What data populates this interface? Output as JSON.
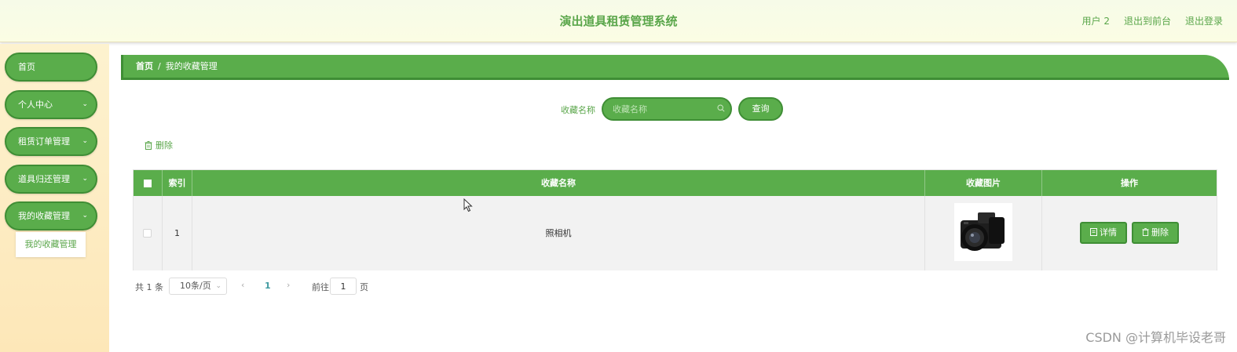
{
  "header": {
    "title": "演出道具租赁管理系统",
    "links": [
      "用户 2",
      "退出到前台",
      "退出登录"
    ]
  },
  "sidebar": {
    "items": [
      {
        "label": "首页",
        "has_arrow": false
      },
      {
        "label": "个人中心",
        "has_arrow": true
      },
      {
        "label": "租赁订单管理",
        "has_arrow": true
      },
      {
        "label": "道具归还管理",
        "has_arrow": true
      },
      {
        "label": "我的收藏管理",
        "has_arrow": true
      }
    ],
    "submenu": {
      "label": "我的收藏管理"
    }
  },
  "breadcrumb": {
    "home": "首页",
    "separator": "/",
    "current": "我的收藏管理"
  },
  "search": {
    "label": "收藏名称",
    "placeholder": "收藏名称",
    "button": "查询"
  },
  "actions": {
    "bulk_delete": "删除"
  },
  "table": {
    "headers": [
      "索引",
      "收藏名称",
      "收藏图片",
      "操作"
    ],
    "rows": [
      {
        "index": "1",
        "name": "照相机",
        "image": "camera-photo",
        "actions": [
          "详情",
          "删除"
        ]
      }
    ]
  },
  "pagination": {
    "total": "共 1 条",
    "page_size": "10条/页",
    "current_page": "1",
    "goto_label": "前往",
    "goto_value": "1",
    "goto_suffix": "页"
  },
  "watermark": "CSDN @计算机毕设老哥",
  "colors": {
    "accent": "#5aad4b",
    "accent_dark": "#3f8e35",
    "text_green": "#5aa64a"
  }
}
